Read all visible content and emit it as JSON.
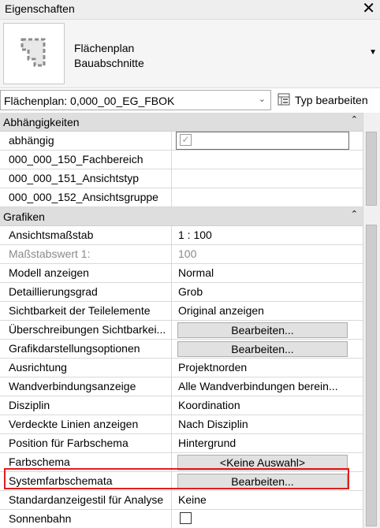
{
  "panel": {
    "title": "Eigenschaften",
    "close_icon": "close-icon"
  },
  "type": {
    "line1": "Flächenplan",
    "line2": "Bauabschnitte",
    "icon": "area-plan-icon"
  },
  "selector": {
    "value": "Flächenplan: 0,000_00_EG_FBOK",
    "edit_type_label": "Typ bearbeiten"
  },
  "groups": [
    {
      "label": "Abhängigkeiten"
    },
    {
      "label": "Grafiken"
    }
  ],
  "rows_constraints": [
    {
      "name": "abhängig",
      "value_type": "checkbox",
      "checked": true,
      "disabled": true
    },
    {
      "name": "000_000_150_Fachbereich",
      "value": ""
    },
    {
      "name": "000_000_151_Ansichtstyp",
      "value": ""
    },
    {
      "name": "000_000_152_Ansichtsgruppe",
      "value": ""
    }
  ],
  "rows_graphics": [
    {
      "name": "Ansichtsmaßstab",
      "value": " 1 : 100"
    },
    {
      "name": "Maßstabswert 1:",
      "value": "100"
    },
    {
      "name": "Modell anzeigen",
      "value": "Normal"
    },
    {
      "name": "Detaillierungsgrad",
      "value": "Grob"
    },
    {
      "name": "Sichtbarkeit der Teilelemente",
      "value": "Original anzeigen"
    },
    {
      "name": "Überschreibungen Sichtbarkei...",
      "value": "Bearbeiten..."
    },
    {
      "name": "Grafikdarstellungsoptionen",
      "value": "Bearbeiten..."
    },
    {
      "name": "Ausrichtung",
      "value": "Projektnorden"
    },
    {
      "name": "Wandverbindungsanzeige",
      "value": "Alle Wandverbindungen berein..."
    },
    {
      "name": "Disziplin",
      "value": "Koordination"
    },
    {
      "name": "Verdeckte Linien anzeigen",
      "value": "Nach Disziplin"
    },
    {
      "name": "Position für Farbschema",
      "value": "Hintergrund"
    },
    {
      "name": "Farbschema",
      "value": "<Keine Auswahl>"
    },
    {
      "name": "Systemfarbschemata",
      "value": "Bearbeiten..."
    },
    {
      "name": "Standardanzeigestil für Analyse",
      "value": "Keine"
    },
    {
      "name": "Sonnenbahn",
      "value_type": "checkbox",
      "checked": false
    }
  ],
  "highlight_color": "#e01e1e"
}
